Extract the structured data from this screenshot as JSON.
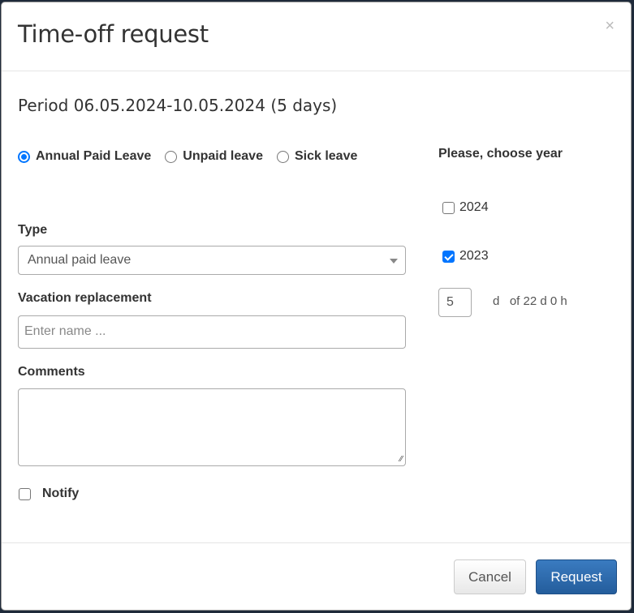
{
  "dialog": {
    "title": "Time-off request",
    "close_icon": "×",
    "period": "Period 06.05.2024-10.05.2024 (5 days)"
  },
  "leave_types": [
    {
      "label": "Annual Paid Leave",
      "checked": true
    },
    {
      "label": "Unpaid leave",
      "checked": false
    },
    {
      "label": "Sick leave",
      "checked": false
    }
  ],
  "form": {
    "type_label": "Type",
    "type_value": "Annual paid leave",
    "replacement_label": "Vacation replacement",
    "replacement_placeholder": "Enter name ...",
    "comments_label": "Comments",
    "comments_value": "",
    "notify_label": "Notify",
    "notify_checked": false
  },
  "year_panel": {
    "title": "Please, choose year",
    "years": [
      {
        "label": "2024",
        "checked": false
      },
      {
        "label": "2023",
        "checked": true
      }
    ],
    "days_value": "5",
    "days_text": "d   of 22 d 0 h"
  },
  "footer": {
    "cancel_label": "Cancel",
    "request_label": "Request"
  },
  "colors": {
    "primary": "#2a6aaa",
    "checkbox_accent": "#0075ff"
  }
}
